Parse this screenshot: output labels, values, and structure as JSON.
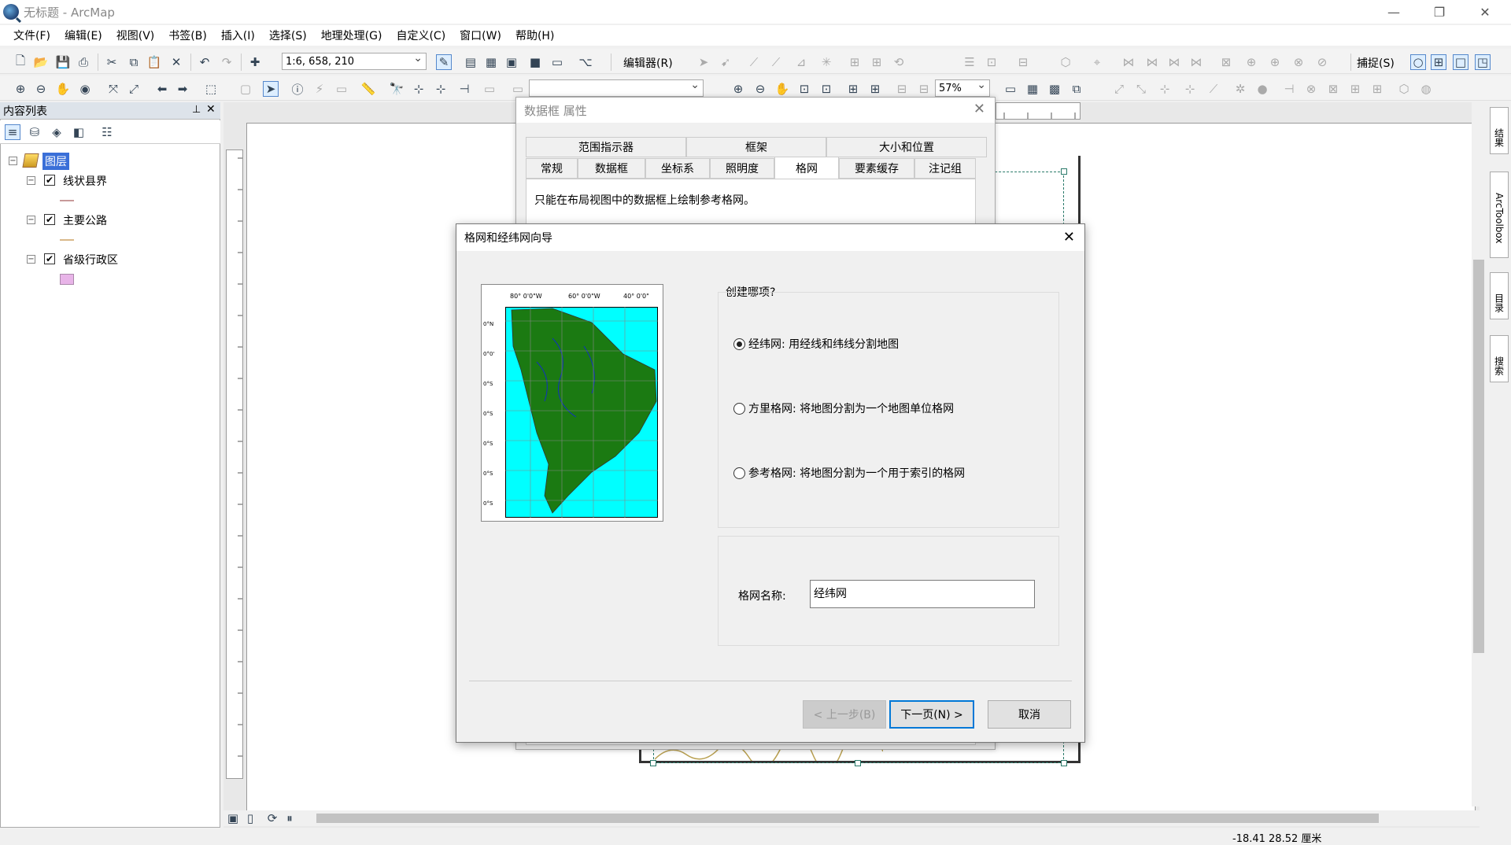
{
  "window": {
    "title": "无标题 - ArcMap"
  },
  "menu": [
    "文件(F)",
    "编辑(E)",
    "视图(V)",
    "书签(B)",
    "插入(I)",
    "选择(S)",
    "地理处理(G)",
    "自定义(C)",
    "窗口(W)",
    "帮助(H)"
  ],
  "toolbar": {
    "scale_value": "1:6, 658, 210",
    "editor_label": "编辑器(R)",
    "snapping_label": "捕捉(S)",
    "zoom_value": "57%"
  },
  "toc": {
    "title": "内容列表",
    "root_label": "图层",
    "layers": [
      {
        "name": "线状县界",
        "checked": true,
        "symbol_color": "#c89a9a"
      },
      {
        "name": "主要公路",
        "checked": true,
        "symbol_color": "#d9b98a"
      },
      {
        "name": "省级行政区",
        "checked": true,
        "symbol_color": "#e8b4e8"
      }
    ]
  },
  "right_dock": [
    "结果",
    "ArcToolbox",
    "目录",
    "搜索"
  ],
  "status": {
    "coords": "-18.41  28.52 厘米"
  },
  "properties_dialog": {
    "title": "数据框 属性",
    "tabs_row1": [
      "范围指示器",
      "框架",
      "大小和位置"
    ],
    "tabs_row2": [
      "常规",
      "数据框",
      "坐标系",
      "照明度",
      "格网",
      "要素缓存",
      "注记组"
    ],
    "active_tab": "格网",
    "note": "只能在布局视图中的数据框上绘制参考格网。"
  },
  "wizard": {
    "title": "格网和经纬网向导",
    "question": "创建哪项?",
    "options": [
      {
        "label": "经纬网: 用经线和纬线分割地图",
        "selected": true
      },
      {
        "label": "方里格网: 将地图分割为一个地图单位格网",
        "selected": false
      },
      {
        "label": "参考格网: 将地图分割为一个用于索引的格网",
        "selected": false
      }
    ],
    "grid_name_label": "格网名称:",
    "grid_name_value": "经纬网",
    "preview": {
      "top_labels": [
        "80° 0'0\"W",
        "60° 0'0\"W",
        "40° 0'0\""
      ],
      "left_labels": [
        "0°N",
        "0°0'",
        "0°S",
        "0°S",
        "0°S",
        "0°S",
        "0°S"
      ]
    },
    "buttons": {
      "back": "< 上一步(B)",
      "next": "下一页(N) >",
      "cancel": "取消"
    }
  },
  "colors": {
    "accent": "#0078d7",
    "ocean": "#00ffff",
    "land": "#1b7a12"
  }
}
